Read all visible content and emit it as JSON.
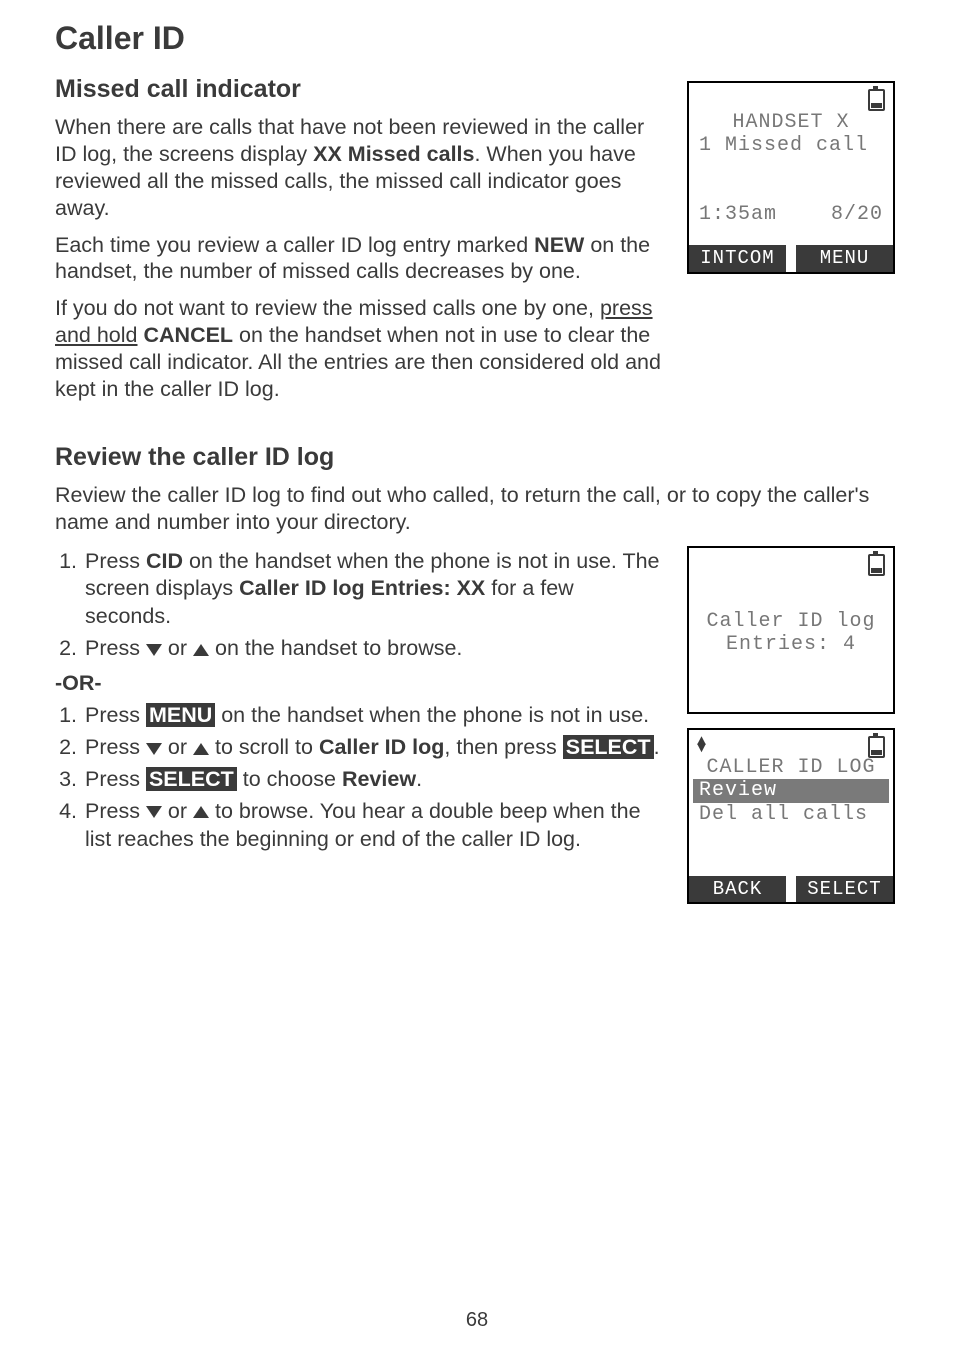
{
  "page_number": "68",
  "title": "Caller ID",
  "section1": {
    "heading": "Missed call indicator",
    "p1_a": "When there are calls that have not been reviewed in the caller ID log, the screens display ",
    "p1_b": "XX Missed calls",
    "p1_c": ". When you have reviewed all the missed calls, the missed call indicator goes away.",
    "p2_a": "Each time you review a caller ID log entry marked ",
    "p2_b": "NEW",
    "p2_c": " on the handset, the number of missed calls decreases by one.",
    "p3_a": "If you do not want to review the missed calls one by one, ",
    "p3_b": "press and hold",
    "p3_c": " ",
    "p3_d": "CANCEL",
    "p3_e": " on the handset when not in use to clear the missed call indicator. All the entries are then considered old and kept in the caller ID log."
  },
  "section2": {
    "heading": "Review the caller ID log",
    "intro": "Review the caller ID log to find out who called, to return the call, or to copy the caller's name and number into your directory.",
    "listA": {
      "i1_a": "Press ",
      "i1_b": "CID",
      "i1_c": " on the handset when the phone is not in use. The screen displays ",
      "i1_d": "Caller ID log Entries: XX",
      "i1_e": " for a few seconds.",
      "i2_a": "Press ",
      "i2_b": " or ",
      "i2_c": " on the handset to browse."
    },
    "or": "-OR-",
    "listB": {
      "i1_a": "Press ",
      "i1_menu": "MENU",
      "i1_b": " on the handset when the phone is not in use.",
      "i2_a": "Press ",
      "i2_b": " or ",
      "i2_c": " to scroll to ",
      "i2_d": "Caller ID log",
      "i2_e": ", then press ",
      "i2_sel": "SELECT",
      "i2_f": ".",
      "i3_a": "Press ",
      "i3_sel": "SELECT",
      "i3_b": " to choose ",
      "i3_c": "Review",
      "i3_d": ".",
      "i4_a": "Press ",
      "i4_b": " or ",
      "i4_c": " to browse. You hear a double beep when the list reaches the beginning or end of the caller ID log."
    }
  },
  "lcd1": {
    "l1": "HANDSET X",
    "l2": "1 Missed call",
    "time": "1:35am",
    "date": "8/20",
    "left": "INTCOM",
    "right": "MENU"
  },
  "lcd2": {
    "l1": "Caller ID log",
    "l2": "Entries: 4"
  },
  "lcd3": {
    "title": "CALLER ID LOG",
    "row_sel": "Review",
    "row2": "Del all calls",
    "left": "BACK",
    "right": "SELECT"
  }
}
